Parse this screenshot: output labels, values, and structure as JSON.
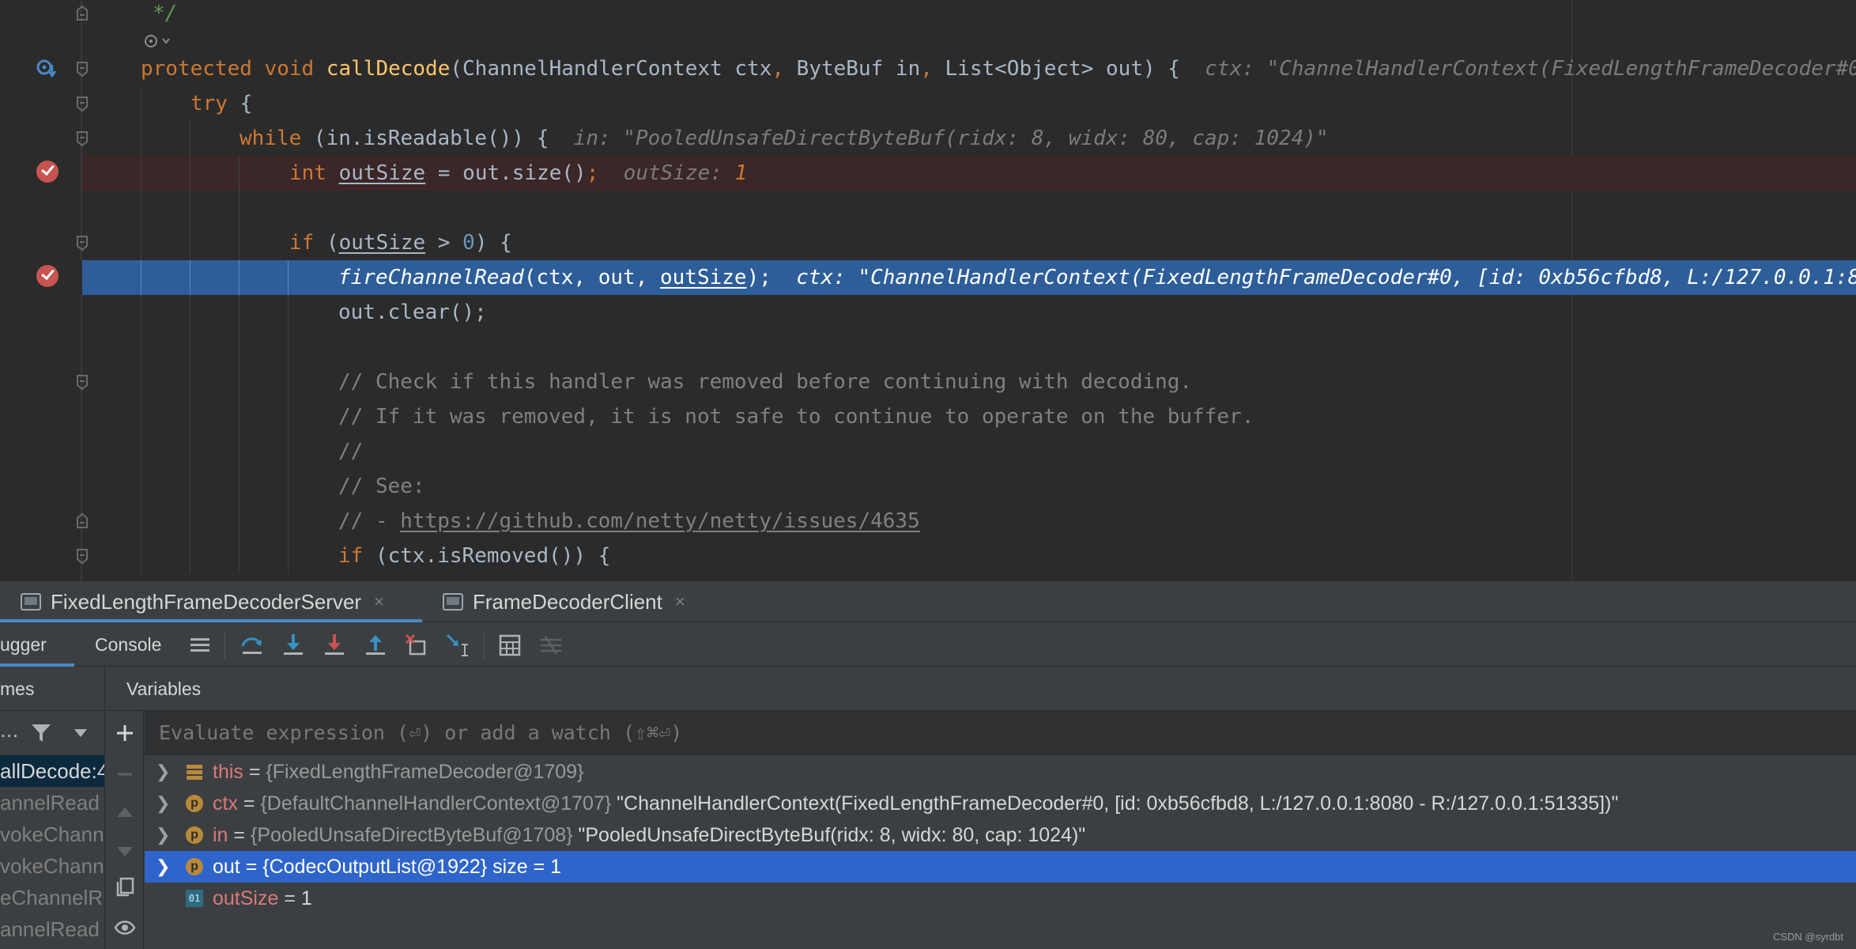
{
  "editor": {
    "lines": {
      "doc_end": "*/",
      "method_sig": {
        "kw1": "protected",
        "kw2": "void",
        "name": "callDecode",
        "params_a": "(ChannelHandlerContext ctx",
        "comma1": ",",
        "params_b": " ByteBuf in",
        "comma2": ",",
        "params_c": " List<Object> out) {",
        "hint": "ctx: \"ChannelHandlerContext(FixedLengthFrameDecoder#0"
      },
      "try_line": {
        "kw": "try",
        "rest": " {"
      },
      "while_line": {
        "kw": "while",
        "rest": " (in.isReadable()) {",
        "hint": "in: \"PooledUnsafeDirectByteBuf(ridx: 8, widx: 80, cap: 1024)\""
      },
      "outsize_line": {
        "kw": "int",
        "var": "outSize",
        "rest": " = out.size()",
        "semi": ";",
        "hint_name": "outSize:",
        "hint_val": "1"
      },
      "if_line": {
        "kw": "if",
        "open": " (",
        "var": "outSize",
        "op": " > ",
        "num": "0",
        "close": ") {"
      },
      "fire_line": {
        "fn": "fireChannelRead",
        "rest_a": "(ctx, out, ",
        "var": "outSize",
        "rest_b": ");",
        "hint": "ctx: \"ChannelHandlerContext(FixedLengthFrameDecoder#0, [id: 0xb56cfbd8, L:/127.0.0.1:8"
      },
      "clear_line": "out.clear();",
      "comment1": "// Check if this handler was removed before continuing with decoding.",
      "comment2": "// If it was removed, it is not safe to continue to operate on the buffer.",
      "comment3": "//",
      "comment4": "// See:",
      "comment5_prefix": "// - ",
      "comment5_link": "https://github.com/netty/netty/issues/4635",
      "removed_line": {
        "kw": "if",
        "rest": " (ctx.isRemoved()) {"
      }
    }
  },
  "run_tabs": [
    {
      "label": "FixedLengthFrameDecoderServer",
      "close": "×"
    },
    {
      "label": "FrameDecoderClient",
      "close": "×"
    }
  ],
  "debug_tabs": {
    "debugger": "ugger",
    "console": "Console"
  },
  "panels": {
    "frames": "mes",
    "variables": "Variables"
  },
  "frames_toolbar": {
    "more": "..."
  },
  "watch": {
    "placeholder": "Evaluate expression (⏎) or add a watch (⇧⌘⏎)"
  },
  "frames": [
    "allDecode:4",
    "annelRead",
    "vokeChann",
    "vokeChann",
    "eChannelR",
    "annelRead"
  ],
  "variables": [
    {
      "name": "this",
      "eq": " = ",
      "type": "{FixedLengthFrameDecoder@1709}",
      "value": "",
      "icon": "field-icon"
    },
    {
      "name": "ctx",
      "eq": " = ",
      "type": "{DefaultChannelHandlerContext@1707}",
      "value": " \"ChannelHandlerContext(FixedLengthFrameDecoder#0, [id: 0xb56cfbd8, L:/127.0.0.1:8080 - R:/127.0.0.1:51335])\"",
      "icon": "p",
      "icon_label": "p"
    },
    {
      "name": "in",
      "eq": " = ",
      "type": "{PooledUnsafeDirectByteBuf@1708}",
      "value": " \"PooledUnsafeDirectByteBuf(ridx: 8, widx: 80, cap: 1024)\"",
      "icon": "p",
      "icon_label": "p"
    },
    {
      "name": "out",
      "eq": " = ",
      "type": "{CodecOutputList@1922}",
      "value": "  size = 1",
      "icon": "p",
      "icon_label": "p"
    },
    {
      "name": "outSize",
      "eq": " = ",
      "type": "",
      "value": "1",
      "icon": "o",
      "icon_label": "01"
    }
  ],
  "watermark": "CSDN @syrdbt",
  "colors": {
    "editor_bg": "#2b2b2b",
    "exec_line": "#2d5e99",
    "breakpoint": "#c75450",
    "selection": "#2f65ca",
    "keyword": "#cc7832",
    "function": "#ffc66d",
    "number": "#6897bb"
  }
}
